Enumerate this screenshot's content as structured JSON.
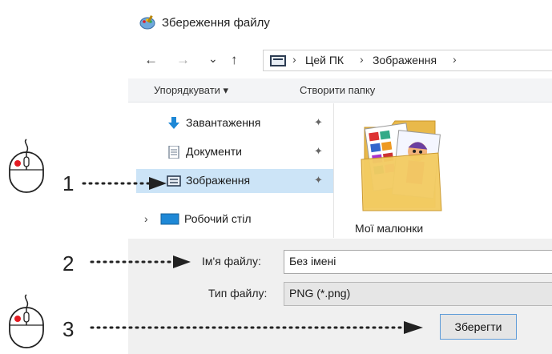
{
  "dialog": {
    "title": "Збереження файлу",
    "nav": {
      "back_icon": "←",
      "forward_icon": "→",
      "recent_icon": "⌄",
      "up_icon": "↑"
    },
    "breadcrumb": {
      "items": [
        "Цей ПК",
        "Зображення"
      ],
      "separators": [
        "›",
        "›",
        "›"
      ]
    },
    "toolbar": {
      "organize_label": "Упорядкувати ▾",
      "new_folder_label": "Створити папку"
    },
    "nav_pane": {
      "items": [
        {
          "label": "Завантаження",
          "icon": "download-arrow-icon",
          "pinned": true
        },
        {
          "label": "Документи",
          "icon": "document-icon",
          "pinned": true
        },
        {
          "label": "Зображення",
          "icon": "pictures-icon",
          "pinned": true,
          "selected": true
        },
        {
          "label": "Робочий стіл",
          "icon": "desktop-icon",
          "expandable": true
        }
      ],
      "pin_glyph": "✦",
      "expand_glyph": "›"
    },
    "files": [
      {
        "name": "Мої малюнки",
        "icon": "folder-icon"
      }
    ],
    "form": {
      "filename_label": "Ім'я файлу:",
      "filename_value": "Без імені",
      "filetype_label": "Тип файлу:",
      "filetype_value": "PNG (*.png)"
    },
    "save_label": "Зберегти"
  },
  "annotations": {
    "steps": [
      "1",
      "2",
      "3"
    ]
  },
  "colors": {
    "selection": "#cce4f7",
    "accent_blue": "#1e88d6",
    "button_border": "#5d9bd8",
    "pointer_red": "#e31b23"
  }
}
